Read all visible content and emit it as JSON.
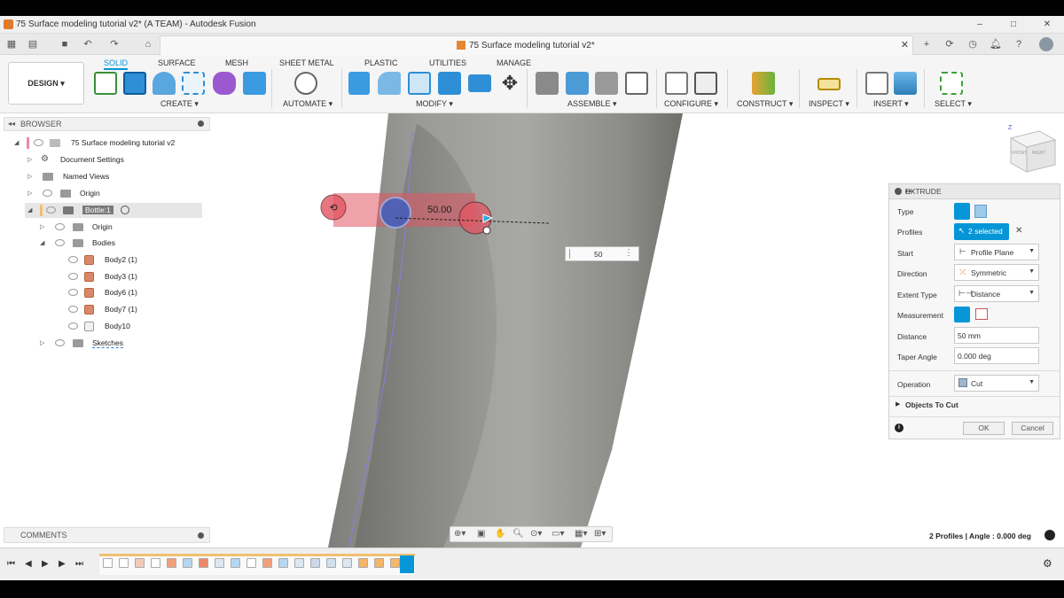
{
  "window": {
    "title": "75 Surface modeling tutorial v2* (A TEAM) - Autodesk Fusion",
    "doc_tab_title": "75 Surface modeling tutorial v2*",
    "min": "–",
    "max": "□",
    "close": "✕"
  },
  "ribbon": {
    "workspace": "DESIGN ▾",
    "tabs": [
      "SOLID",
      "SURFACE",
      "MESH",
      "SHEET METAL",
      "PLASTIC",
      "UTILITIES",
      "MANAGE"
    ],
    "active_tab": "SOLID",
    "groups": [
      "CREATE ▾",
      "AUTOMATE ▾",
      "MODIFY ▾",
      "ASSEMBLE ▾",
      "CONFIGURE ▾",
      "CONSTRUCT ▾",
      "INSPECT ▾",
      "INSERT ▾",
      "SELECT ▾"
    ]
  },
  "browser": {
    "title": "BROWSER",
    "items": [
      {
        "label": "75 Surface modeling tutorial v2"
      },
      {
        "label": "Document Settings"
      },
      {
        "label": "Named Views"
      },
      {
        "label": "Origin"
      },
      {
        "label": "Bottle:1"
      },
      {
        "label": "Origin"
      },
      {
        "label": "Bodies"
      },
      {
        "label": "Body2 (1)"
      },
      {
        "label": "Body3 (1)"
      },
      {
        "label": "Body6 (1)"
      },
      {
        "label": "Body7 (1)"
      },
      {
        "label": "Body10"
      },
      {
        "label": "Sketches"
      }
    ]
  },
  "comments": {
    "title": "COMMENTS"
  },
  "viewport": {
    "dimension_label": "50.00",
    "distance_input": "50",
    "viewcube_labels": [
      "FRONT",
      "RIGHT"
    ],
    "status": "2 Profiles | Angle : 0.000 deg"
  },
  "extrude": {
    "title": "EXTRUDE",
    "type_label": "Type",
    "profiles_label": "Profiles",
    "profiles_value": "2 selected",
    "start_label": "Start",
    "start_value": "Profile Plane",
    "direction_label": "Direction",
    "direction_value": "Symmetric",
    "extent_label": "Extent Type",
    "extent_value": "Distance",
    "measurement_label": "Measurement",
    "distance_label": "Distance",
    "distance_value": "50 mm",
    "taper_label": "Taper Angle",
    "taper_value": "0.000 deg",
    "operation_label": "Operation",
    "operation_value": "Cut",
    "objects_to_cut": "Objects To Cut",
    "ok": "OK",
    "cancel": "Cancel"
  },
  "colors": {
    "accent": "#0696d7",
    "model": "#8f8f8c",
    "extrude_red": "#e25563"
  }
}
